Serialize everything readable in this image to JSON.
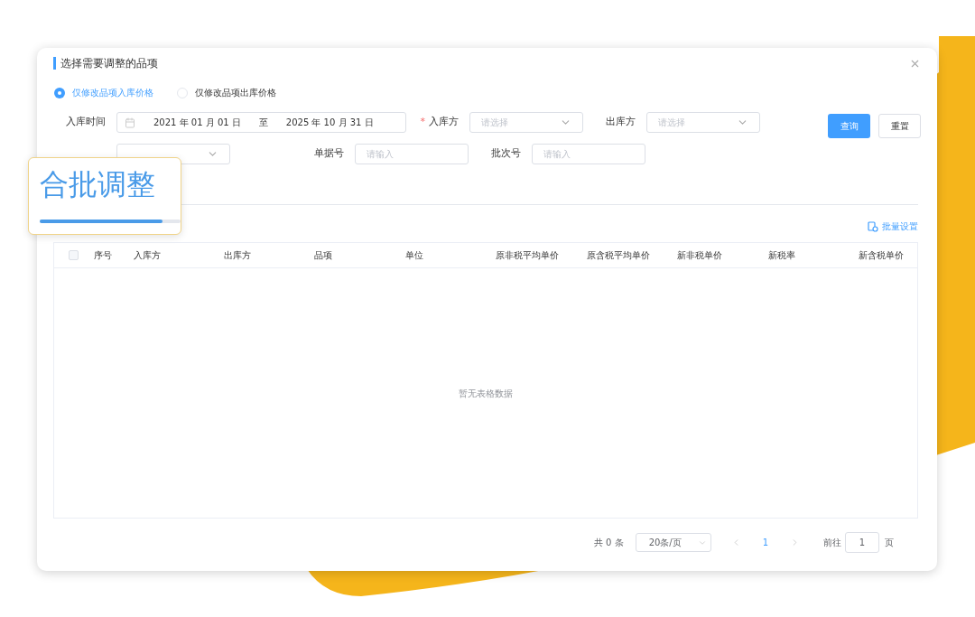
{
  "dialog": {
    "title": "选择需要调整的品项"
  },
  "modes": [
    {
      "label": "仅修改品项入库价格",
      "selected": true
    },
    {
      "label": "仅修改品项出库价格",
      "selected": false
    }
  ],
  "filters": {
    "date_label": "入库时间",
    "date_start": "2021 年 01 月 01 日",
    "date_separator": "至",
    "date_end": "2025 年 10 月 31 日",
    "required_mark": "*",
    "row1": [
      {
        "label": "入库方",
        "required": true,
        "placeholder": "请选择",
        "kind": "select"
      },
      {
        "label": "出库方",
        "required": false,
        "placeholder": "请选择",
        "kind": "select"
      }
    ],
    "row2": [
      {
        "kind": "select"
      },
      {
        "label": "单据号",
        "required": false,
        "placeholder": "请输入",
        "kind": "input"
      },
      {
        "label": "批次号",
        "required": false,
        "placeholder": "请输入",
        "kind": "input"
      }
    ]
  },
  "buttons": [
    {
      "label": "查询",
      "kind": "primary"
    },
    {
      "label": "重置",
      "kind": "default"
    }
  ],
  "batch_settings": "批量设置",
  "table": {
    "select_all_checked": false,
    "columns": [
      "序号",
      "入库方",
      "出库方",
      "品项",
      "单位",
      "原非税平均单价",
      "原含税平均单价",
      "新非税单价",
      "新税率",
      "新含税单价"
    ],
    "empty_text": "暂无表格数据"
  },
  "pagination": {
    "total": "共 0 条",
    "page_size": "20条/页",
    "pages": [
      {
        "label": "1",
        "selected": true
      }
    ],
    "goto_label": "前往",
    "goto_value": "1",
    "page_suffix": "页"
  },
  "callout": {
    "title": "合批调整",
    "level": 0.87
  }
}
